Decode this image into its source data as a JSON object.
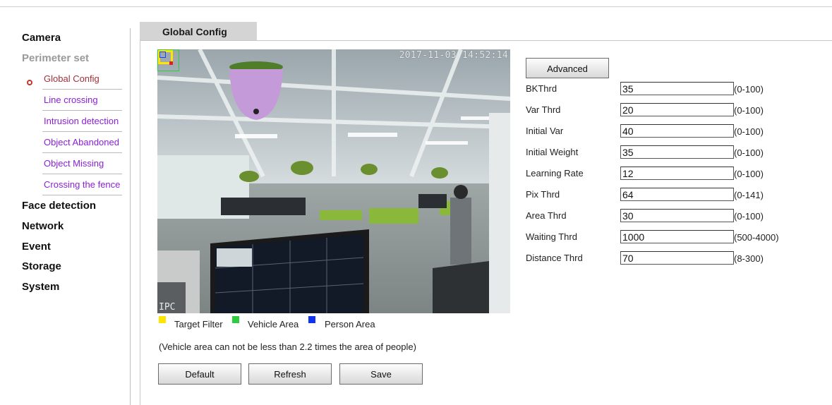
{
  "sidebar": {
    "camera": "Camera",
    "perimeter": "Perimeter set",
    "items": [
      {
        "label": "Global Config",
        "active": true
      },
      {
        "label": "Line crossing"
      },
      {
        "label": "Intrusion detection"
      },
      {
        "label": "Object Abandoned"
      },
      {
        "label": "Object Missing"
      },
      {
        "label": "Crossing the fence"
      }
    ],
    "face_detection": "Face detection",
    "network": "Network",
    "event": "Event",
    "storage": "Storage",
    "system": "System"
  },
  "tab": {
    "label": "Global Config"
  },
  "video": {
    "timestamp": "2017-11-03 14:52:14",
    "label": "IPC"
  },
  "legend": {
    "target_filter": {
      "label": "Target Filter",
      "color": "#ffe600"
    },
    "vehicle_area": {
      "label": "Vehicle Area",
      "color": "#2ecc40"
    },
    "person_area": {
      "label": "Person Area",
      "color": "#1133ee"
    }
  },
  "note": "(Vehicle area can not be less than 2.2 times the area of people)",
  "buttons": {
    "default": "Default",
    "refresh": "Refresh",
    "save": "Save",
    "advanced": "Advanced"
  },
  "params": [
    {
      "label": "BKThrd",
      "value": "35",
      "range": "(0-100)"
    },
    {
      "label": "Var Thrd",
      "value": "20",
      "range": "(0-100)"
    },
    {
      "label": "Initial Var",
      "value": "40",
      "range": "(0-100)"
    },
    {
      "label": "Initial Weight",
      "value": "35",
      "range": "(0-100)"
    },
    {
      "label": "Learning Rate",
      "value": "12",
      "range": "(0-100)"
    },
    {
      "label": "Pix Thrd",
      "value": "64",
      "range": "(0-141)"
    },
    {
      "label": "Area Thrd",
      "value": "30",
      "range": "(0-100)"
    },
    {
      "label": "Waiting Thrd",
      "value": "1000",
      "range": "(500-4000)"
    },
    {
      "label": "Distance Thrd",
      "value": "70",
      "range": "(8-300)"
    }
  ]
}
